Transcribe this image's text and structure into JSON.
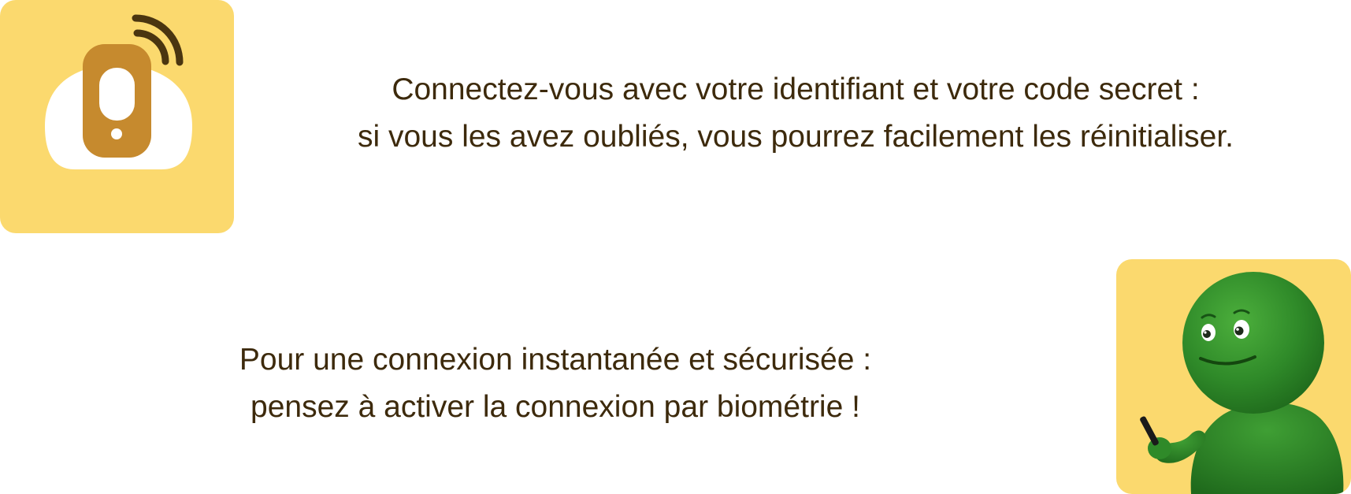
{
  "login_info": {
    "line1": "Connectez-vous avec votre identifiant et votre code secret :",
    "line2": "si vous les avez oubliés, vous pourrez facilement les réinitialiser."
  },
  "biometric_info": {
    "line1": "Pour une connexion instantanée et sécurisée :",
    "line2": "pensez à activer la connexion par biométrie !"
  },
  "icons": {
    "phone_card": "smartphone-wireless-icon",
    "mascot_card": "green-mascot-with-phone-icon"
  },
  "colors": {
    "card_background": "#fbd96e",
    "phone_body": "#c68a2e",
    "signal_waves": "#4a3510",
    "text": "#3d2a0c",
    "mascot_green": "#2e8b2a"
  }
}
